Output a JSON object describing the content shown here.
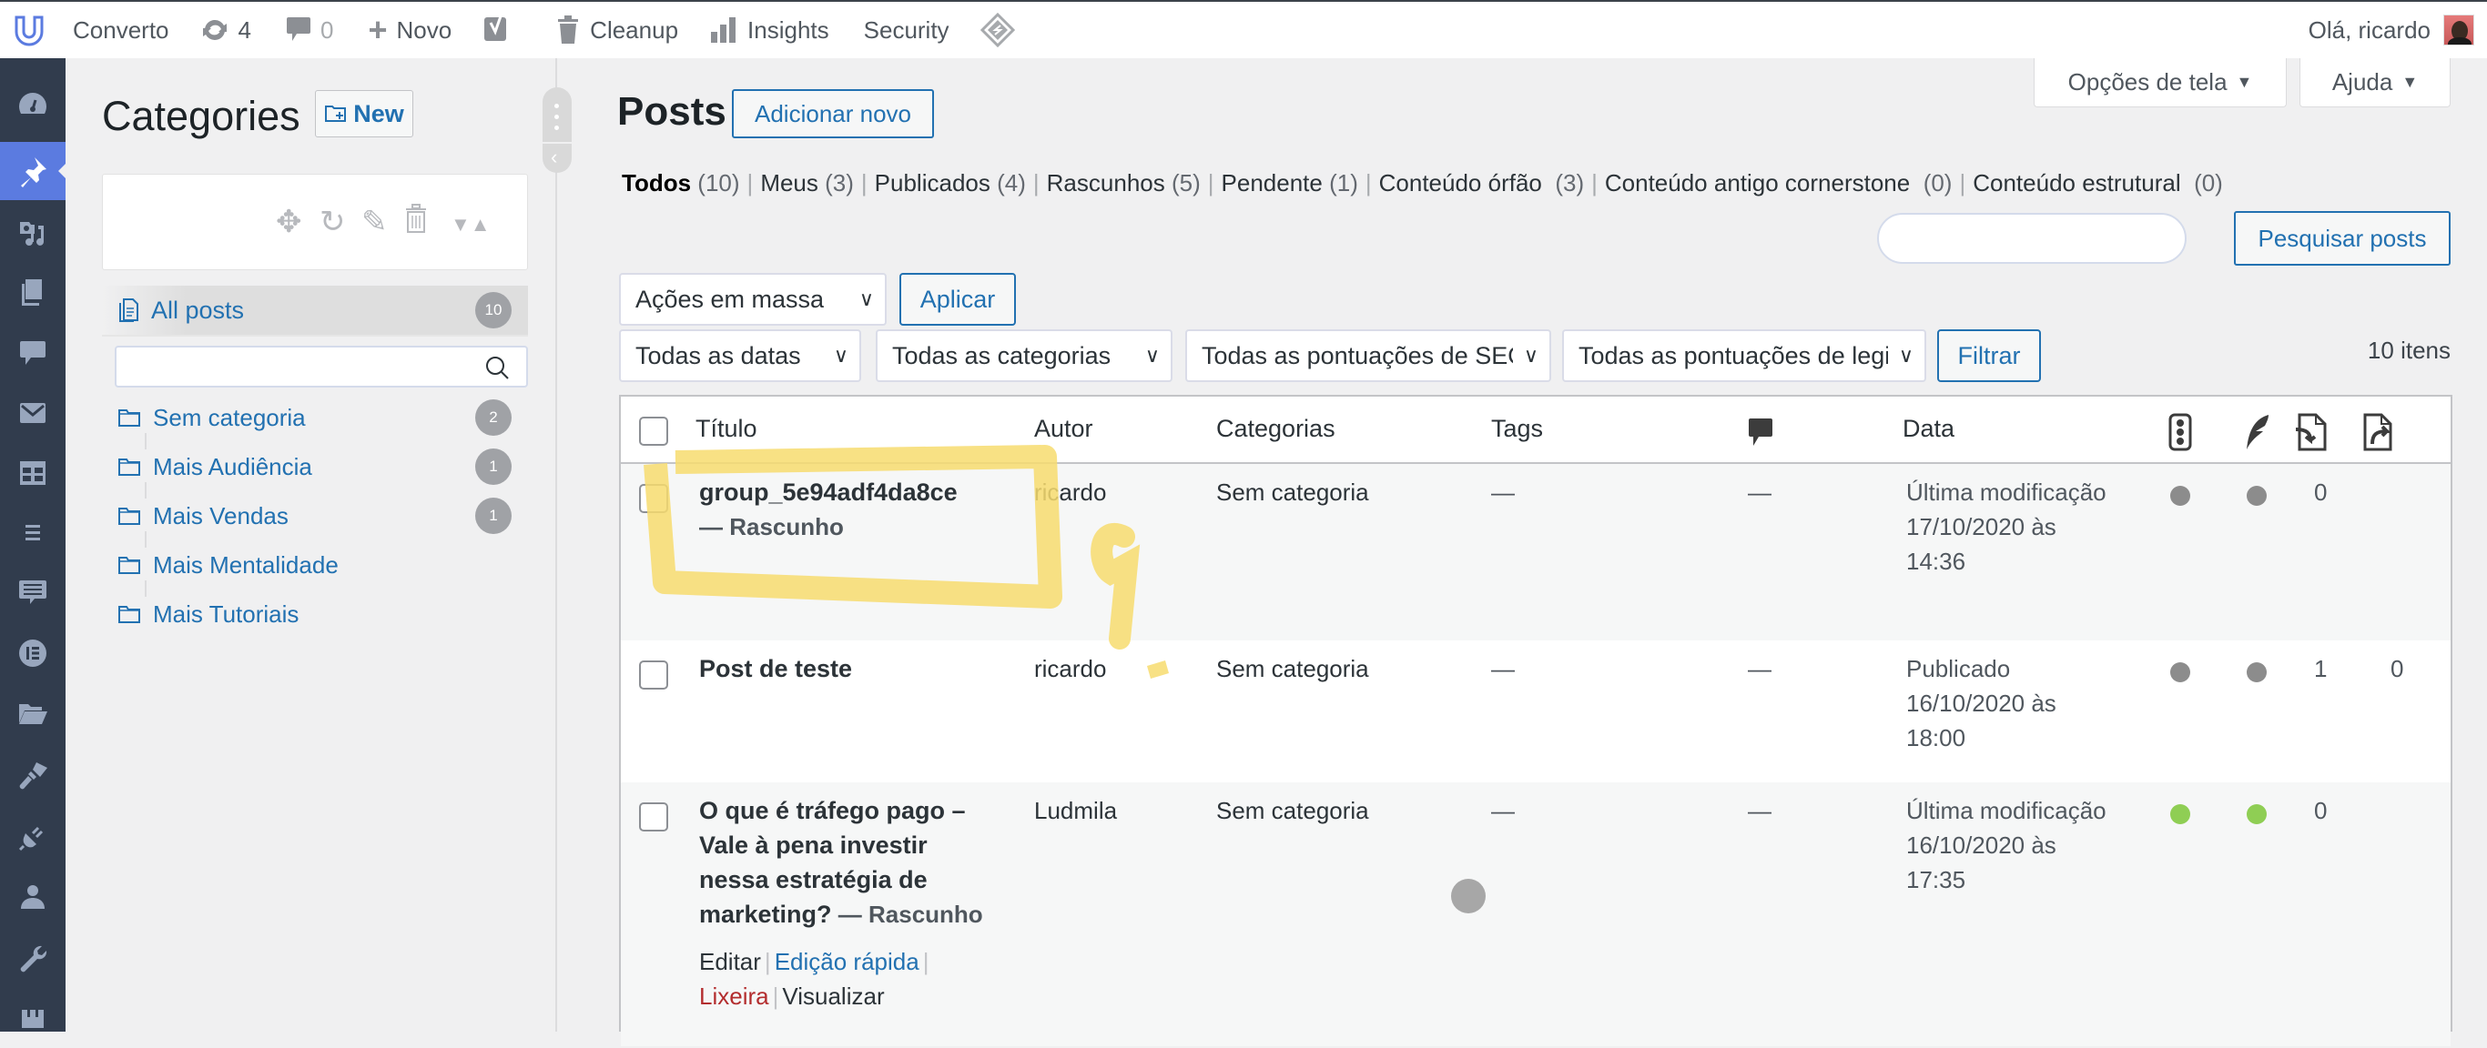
{
  "adminbar": {
    "site_name": "Converto",
    "updates_count": "4",
    "comments_count": "0",
    "new_label": "Novo",
    "cleanup_label": "Cleanup",
    "insights_label": "Insights",
    "security_label": "Security",
    "greeting": "Olá, ricardo"
  },
  "sidebar": {
    "items": [
      {
        "name": "dashboard"
      },
      {
        "name": "posts",
        "active": true
      },
      {
        "name": "media"
      },
      {
        "name": "pages"
      },
      {
        "name": "comments"
      },
      {
        "name": "contact"
      },
      {
        "name": "tables"
      },
      {
        "name": "menu"
      },
      {
        "name": "feedback"
      },
      {
        "name": "elementor"
      },
      {
        "name": "files"
      },
      {
        "name": "appearance"
      },
      {
        "name": "plugins"
      },
      {
        "name": "users"
      },
      {
        "name": "tools"
      }
    ]
  },
  "categories_panel": {
    "title": "Categories",
    "new_label": "New",
    "all_posts": {
      "label": "All posts",
      "count": "10"
    },
    "search_placeholder": "",
    "items": [
      {
        "label": "Sem categoria",
        "count": "2"
      },
      {
        "label": "Mais Audiência",
        "count": "1"
      },
      {
        "label": "Mais Vendas",
        "count": "1"
      },
      {
        "label": "Mais Mentalidade",
        "count": ""
      },
      {
        "label": "Mais Tutoriais",
        "count": ""
      }
    ]
  },
  "screen_options": {
    "screen_label": "Opções de tela",
    "help_label": "Ajuda"
  },
  "page": {
    "title": "Posts",
    "add_new_label": "Adicionar novo",
    "views": [
      {
        "label": "Todos",
        "count": "(10)",
        "current": true
      },
      {
        "label": "Meus",
        "count": "(3)"
      },
      {
        "label": "Publicados",
        "count": "(4)"
      },
      {
        "label": "Rascunhos",
        "count": "(5)"
      },
      {
        "label": "Pendente",
        "count": "(1)"
      },
      {
        "label": "Conteúdo órfão",
        "count": "(3)"
      },
      {
        "label": "Conteúdo antigo cornerstone",
        "count": "(0)"
      },
      {
        "label": "Conteúdo estrutural",
        "count": "(0)"
      }
    ],
    "search_value": "",
    "search_button": "Pesquisar posts",
    "bulk_actions": "Ações em massa",
    "apply_label": "Aplicar",
    "filters": {
      "dates": "Todas as datas",
      "categories": "Todas as categorias",
      "seo_scores": "Todas as pontuações de SEO",
      "readability_scores": "Todas as pontuações de legibilidade"
    },
    "filter_button": "Filtrar",
    "items_count": "10 itens"
  },
  "table": {
    "columns": {
      "title": "Título",
      "author": "Autor",
      "categories": "Categorias",
      "tags": "Tags",
      "comments_icon": "comment-icon",
      "date": "Data",
      "seo_icon": "traffic-light-icon",
      "readability_icon": "feather-icon",
      "incoming_links_icon": "incoming-links-icon",
      "outgoing_links_icon": "outgoing-links-icon"
    },
    "rows": [
      {
        "title": "group_5e94adf4da8ce",
        "state": "— Rascunho",
        "author": "ricardo",
        "categories": "Sem categoria",
        "tags": "—",
        "comments": "—",
        "date_status": "Última modificação",
        "date_line": "17/10/2020 às",
        "time": "14:36",
        "seo_color": "#8c8c8c",
        "readability_color": "#8c8c8c",
        "incoming": "0",
        "outgoing": ""
      },
      {
        "title": "Post de teste",
        "state": "",
        "author": "ricardo",
        "categories": "Sem categoria",
        "tags": "—",
        "comments": "—",
        "date_status": "Publicado",
        "date_line": "16/10/2020 às",
        "time": "18:00",
        "seo_color": "#8c8c8c",
        "readability_color": "#8c8c8c",
        "incoming": "1",
        "outgoing": "0"
      },
      {
        "title_lines": [
          "O que é tráfego pago –",
          "Vale à pena investir",
          "nessa estratégia de",
          "marketing?"
        ],
        "state": "— Rascunho",
        "author": "Ludmila",
        "categories": "Sem categoria",
        "tags": "—",
        "comments": "—",
        "date_status": "Última modificação",
        "date_line": "16/10/2020 às",
        "time": "17:35",
        "seo_color": "#8fce54",
        "readability_color": "#8fce54",
        "incoming": "0",
        "outgoing": "",
        "actions": {
          "edit": "Editar",
          "quick_edit": "Edição rápida",
          "trash": "Lixeira",
          "view": "Visualizar"
        }
      }
    ]
  },
  "colors": {
    "accent": "#2271b1",
    "sidebar_bg": "#313c4d",
    "sidebar_active": "#5b7be0",
    "trash": "#b32d2e",
    "annotation": "#f7dc6f"
  }
}
